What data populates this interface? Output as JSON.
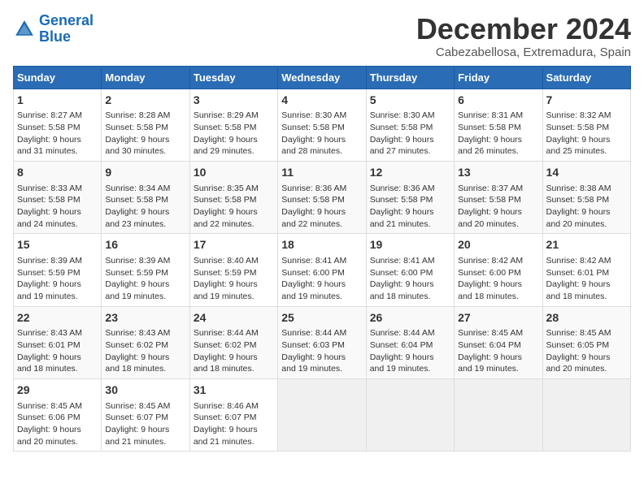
{
  "logo": {
    "line1": "General",
    "line2": "Blue"
  },
  "title": "December 2024",
  "subtitle": "Cabezabellosa, Extremadura, Spain",
  "days_of_week": [
    "Sunday",
    "Monday",
    "Tuesday",
    "Wednesday",
    "Thursday",
    "Friday",
    "Saturday"
  ],
  "weeks": [
    [
      {
        "day": "1",
        "info": "Sunrise: 8:27 AM\nSunset: 5:58 PM\nDaylight: 9 hours\nand 31 minutes."
      },
      {
        "day": "2",
        "info": "Sunrise: 8:28 AM\nSunset: 5:58 PM\nDaylight: 9 hours\nand 30 minutes."
      },
      {
        "day": "3",
        "info": "Sunrise: 8:29 AM\nSunset: 5:58 PM\nDaylight: 9 hours\nand 29 minutes."
      },
      {
        "day": "4",
        "info": "Sunrise: 8:30 AM\nSunset: 5:58 PM\nDaylight: 9 hours\nand 28 minutes."
      },
      {
        "day": "5",
        "info": "Sunrise: 8:30 AM\nSunset: 5:58 PM\nDaylight: 9 hours\nand 27 minutes."
      },
      {
        "day": "6",
        "info": "Sunrise: 8:31 AM\nSunset: 5:58 PM\nDaylight: 9 hours\nand 26 minutes."
      },
      {
        "day": "7",
        "info": "Sunrise: 8:32 AM\nSunset: 5:58 PM\nDaylight: 9 hours\nand 25 minutes."
      }
    ],
    [
      {
        "day": "8",
        "info": "Sunrise: 8:33 AM\nSunset: 5:58 PM\nDaylight: 9 hours\nand 24 minutes."
      },
      {
        "day": "9",
        "info": "Sunrise: 8:34 AM\nSunset: 5:58 PM\nDaylight: 9 hours\nand 23 minutes."
      },
      {
        "day": "10",
        "info": "Sunrise: 8:35 AM\nSunset: 5:58 PM\nDaylight: 9 hours\nand 22 minutes."
      },
      {
        "day": "11",
        "info": "Sunrise: 8:36 AM\nSunset: 5:58 PM\nDaylight: 9 hours\nand 22 minutes."
      },
      {
        "day": "12",
        "info": "Sunrise: 8:36 AM\nSunset: 5:58 PM\nDaylight: 9 hours\nand 21 minutes."
      },
      {
        "day": "13",
        "info": "Sunrise: 8:37 AM\nSunset: 5:58 PM\nDaylight: 9 hours\nand 20 minutes."
      },
      {
        "day": "14",
        "info": "Sunrise: 8:38 AM\nSunset: 5:58 PM\nDaylight: 9 hours\nand 20 minutes."
      }
    ],
    [
      {
        "day": "15",
        "info": "Sunrise: 8:39 AM\nSunset: 5:59 PM\nDaylight: 9 hours\nand 19 minutes."
      },
      {
        "day": "16",
        "info": "Sunrise: 8:39 AM\nSunset: 5:59 PM\nDaylight: 9 hours\nand 19 minutes."
      },
      {
        "day": "17",
        "info": "Sunrise: 8:40 AM\nSunset: 5:59 PM\nDaylight: 9 hours\nand 19 minutes."
      },
      {
        "day": "18",
        "info": "Sunrise: 8:41 AM\nSunset: 6:00 PM\nDaylight: 9 hours\nand 19 minutes."
      },
      {
        "day": "19",
        "info": "Sunrise: 8:41 AM\nSunset: 6:00 PM\nDaylight: 9 hours\nand 18 minutes."
      },
      {
        "day": "20",
        "info": "Sunrise: 8:42 AM\nSunset: 6:00 PM\nDaylight: 9 hours\nand 18 minutes."
      },
      {
        "day": "21",
        "info": "Sunrise: 8:42 AM\nSunset: 6:01 PM\nDaylight: 9 hours\nand 18 minutes."
      }
    ],
    [
      {
        "day": "22",
        "info": "Sunrise: 8:43 AM\nSunset: 6:01 PM\nDaylight: 9 hours\nand 18 minutes."
      },
      {
        "day": "23",
        "info": "Sunrise: 8:43 AM\nSunset: 6:02 PM\nDaylight: 9 hours\nand 18 minutes."
      },
      {
        "day": "24",
        "info": "Sunrise: 8:44 AM\nSunset: 6:02 PM\nDaylight: 9 hours\nand 18 minutes."
      },
      {
        "day": "25",
        "info": "Sunrise: 8:44 AM\nSunset: 6:03 PM\nDaylight: 9 hours\nand 19 minutes."
      },
      {
        "day": "26",
        "info": "Sunrise: 8:44 AM\nSunset: 6:04 PM\nDaylight: 9 hours\nand 19 minutes."
      },
      {
        "day": "27",
        "info": "Sunrise: 8:45 AM\nSunset: 6:04 PM\nDaylight: 9 hours\nand 19 minutes."
      },
      {
        "day": "28",
        "info": "Sunrise: 8:45 AM\nSunset: 6:05 PM\nDaylight: 9 hours\nand 20 minutes."
      }
    ],
    [
      {
        "day": "29",
        "info": "Sunrise: 8:45 AM\nSunset: 6:06 PM\nDaylight: 9 hours\nand 20 minutes."
      },
      {
        "day": "30",
        "info": "Sunrise: 8:45 AM\nSunset: 6:07 PM\nDaylight: 9 hours\nand 21 minutes."
      },
      {
        "day": "31",
        "info": "Sunrise: 8:46 AM\nSunset: 6:07 PM\nDaylight: 9 hours\nand 21 minutes."
      },
      {
        "day": "",
        "info": ""
      },
      {
        "day": "",
        "info": ""
      },
      {
        "day": "",
        "info": ""
      },
      {
        "day": "",
        "info": ""
      }
    ]
  ]
}
